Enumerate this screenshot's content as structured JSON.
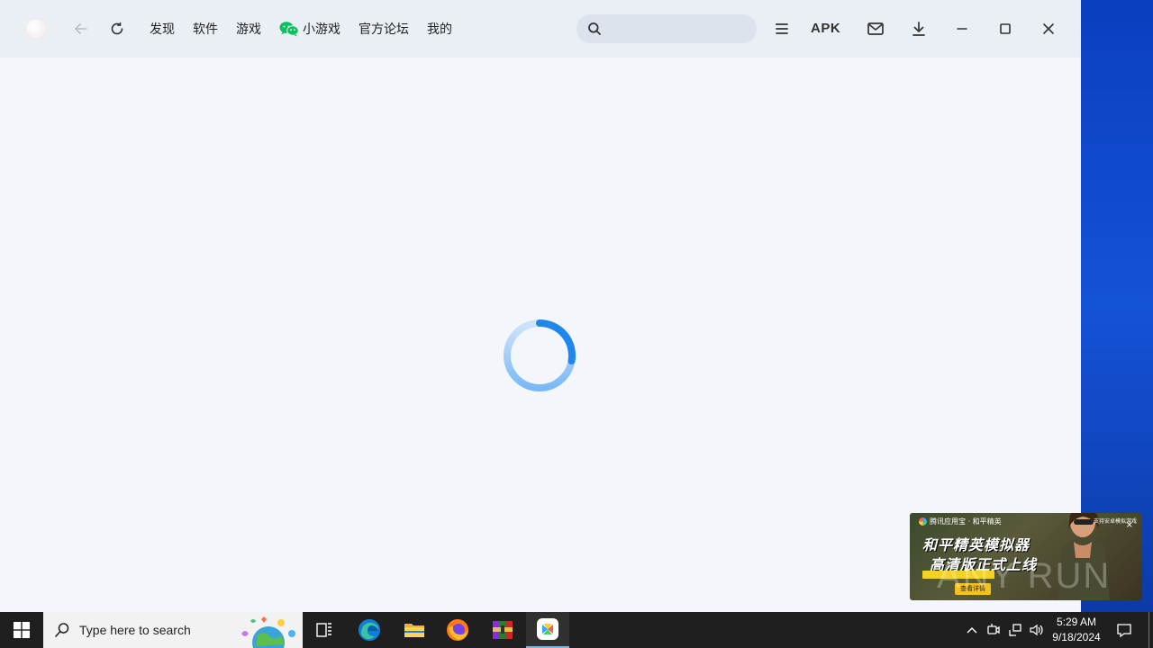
{
  "nav": {
    "items": [
      {
        "label": "发现"
      },
      {
        "label": "软件"
      },
      {
        "label": "游戏"
      },
      {
        "label": "小游戏"
      },
      {
        "label": "官方论坛"
      },
      {
        "label": "我的"
      }
    ]
  },
  "search": {
    "placeholder": "",
    "value": ""
  },
  "toolbar": {
    "apk_label": "APK"
  },
  "ad": {
    "brand": "腾讯应用宝 · 和平精英",
    "tag": "支持安卓模拟游戏",
    "title_line1": "和平精英模拟器",
    "title_line2": "高清版正式上线",
    "badge": "",
    "cta": "查看详情",
    "close": "×"
  },
  "watermark": "ANY RUN",
  "taskbar": {
    "search_placeholder": "Type here to search",
    "time": "5:29 AM",
    "date": "9/18/2024"
  },
  "colors": {
    "spinner": "#2a8cf0",
    "accent": "#76b9ed",
    "wechat": "#07c160"
  }
}
